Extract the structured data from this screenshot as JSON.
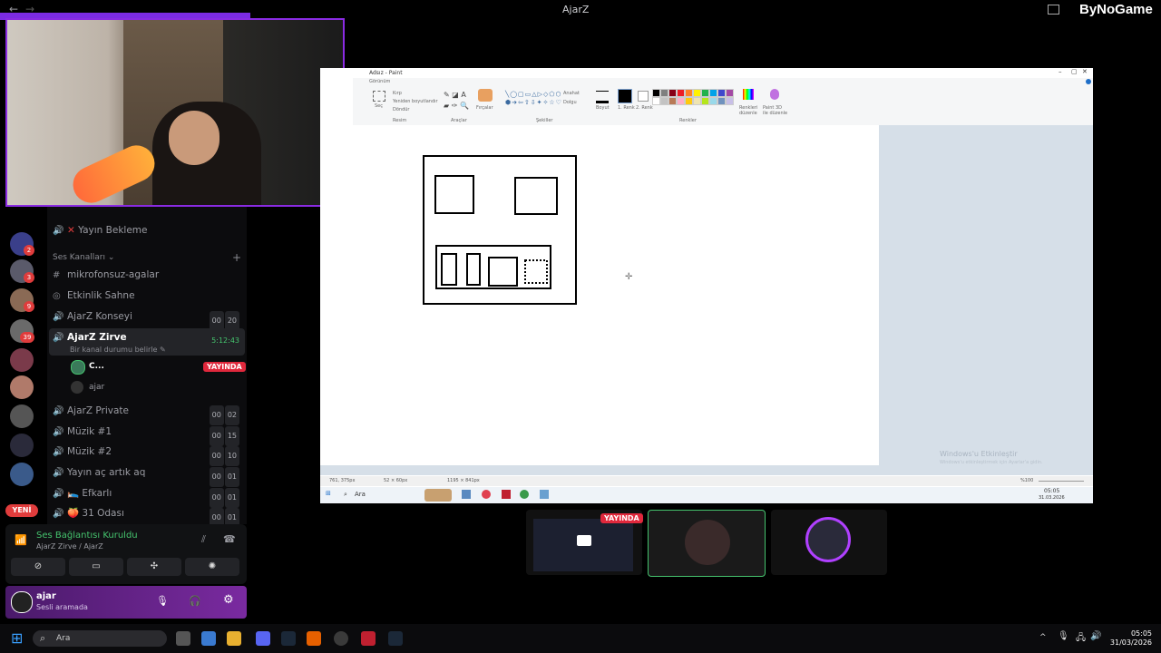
{
  "window": {
    "title": "AjarZ",
    "brand": "ByNoGame"
  },
  "paint": {
    "title": "Adsız - Paint",
    "menu_view": "Görünüm",
    "groups": [
      "Resim",
      "Araçlar",
      "Şekiller",
      "Renkler"
    ],
    "tools": {
      "select": "Seç",
      "crop": "Kırp",
      "resize": "Yeniden boyutlandır",
      "rotate": "Döndür",
      "brushes": "Fırçalar",
      "outline": "Anahat",
      "fill": "Dolgu",
      "size": "Boyut",
      "color1": "1. Renk",
      "color2": "2. Renk",
      "edit_colors": "Renkleri düzenle",
      "paint3d": "Paint 3D ile düzenle"
    },
    "status": {
      "cursor": "761, 375px",
      "selection": "52 × 60px",
      "size": "1195 × 841px",
      "zoom": "%100"
    },
    "palette": [
      "#000000",
      "#7f7f7f",
      "#880015",
      "#ed1c24",
      "#ff7f27",
      "#fff200",
      "#22b14c",
      "#00a2e8",
      "#3f48cc",
      "#a349a4",
      "#ffffff",
      "#c3c3c3",
      "#b97a57",
      "#ffaec9",
      "#ffc90e",
      "#efe4b0",
      "#b5e61d",
      "#99d9ea",
      "#7092be",
      "#c8bfe7"
    ]
  },
  "inner_taskbar": {
    "search": "Ara",
    "time": "05:05",
    "date": "31.03.2026"
  },
  "watermark": {
    "line1": "Windows'u Etkinleştir",
    "line2": "Windows'u etkinleştirmek için Ayarlar'a gidin."
  },
  "discord": {
    "top_channel": "Yayın Bekleme",
    "section": "Ses Kanalları",
    "channels": [
      {
        "name": "mikrofonsuz-agalar",
        "icon": "hash"
      },
      {
        "name": "Etkinlik Sahne",
        "icon": "stage"
      },
      {
        "name": "AjarZ Konseyi",
        "icon": "speaker",
        "count": [
          "00",
          "20"
        ]
      }
    ],
    "active": {
      "name": "AjarZ Zirve",
      "timer": "5:12:43",
      "status": "Bir kanal durumu belirle"
    },
    "members": [
      {
        "name": "C...",
        "live": "YAYINDA"
      },
      {
        "name": "ajar"
      }
    ],
    "channels2": [
      {
        "name": "AjarZ Private",
        "count": [
          "00",
          "02"
        ]
      },
      {
        "name": "Müzik #1",
        "count": [
          "00",
          "15"
        ]
      },
      {
        "name": "Müzik #2",
        "count": [
          "00",
          "10"
        ]
      },
      {
        "name": "Yayın aç artık aq",
        "count": [
          "00",
          "01"
        ]
      },
      {
        "name": "Efkarlı",
        "count": [
          "00",
          "01"
        ]
      },
      {
        "name": "31 Odası",
        "count": [
          "00",
          "01"
        ]
      }
    ],
    "server_badges": [
      "2",
      "3",
      "9",
      "39"
    ],
    "new_badge": "YENİ",
    "voice": {
      "title": "Ses Bağlantısı Kuruldu",
      "sub": "AjarZ Zirve / AjarZ"
    },
    "user": {
      "name": "ajar",
      "status": "Sesli aramada"
    }
  },
  "stream_tiles": {
    "live": "YAYINDA"
  },
  "taskbar": {
    "search": "Ara",
    "time": "05:05",
    "date": "31/03/2026"
  }
}
